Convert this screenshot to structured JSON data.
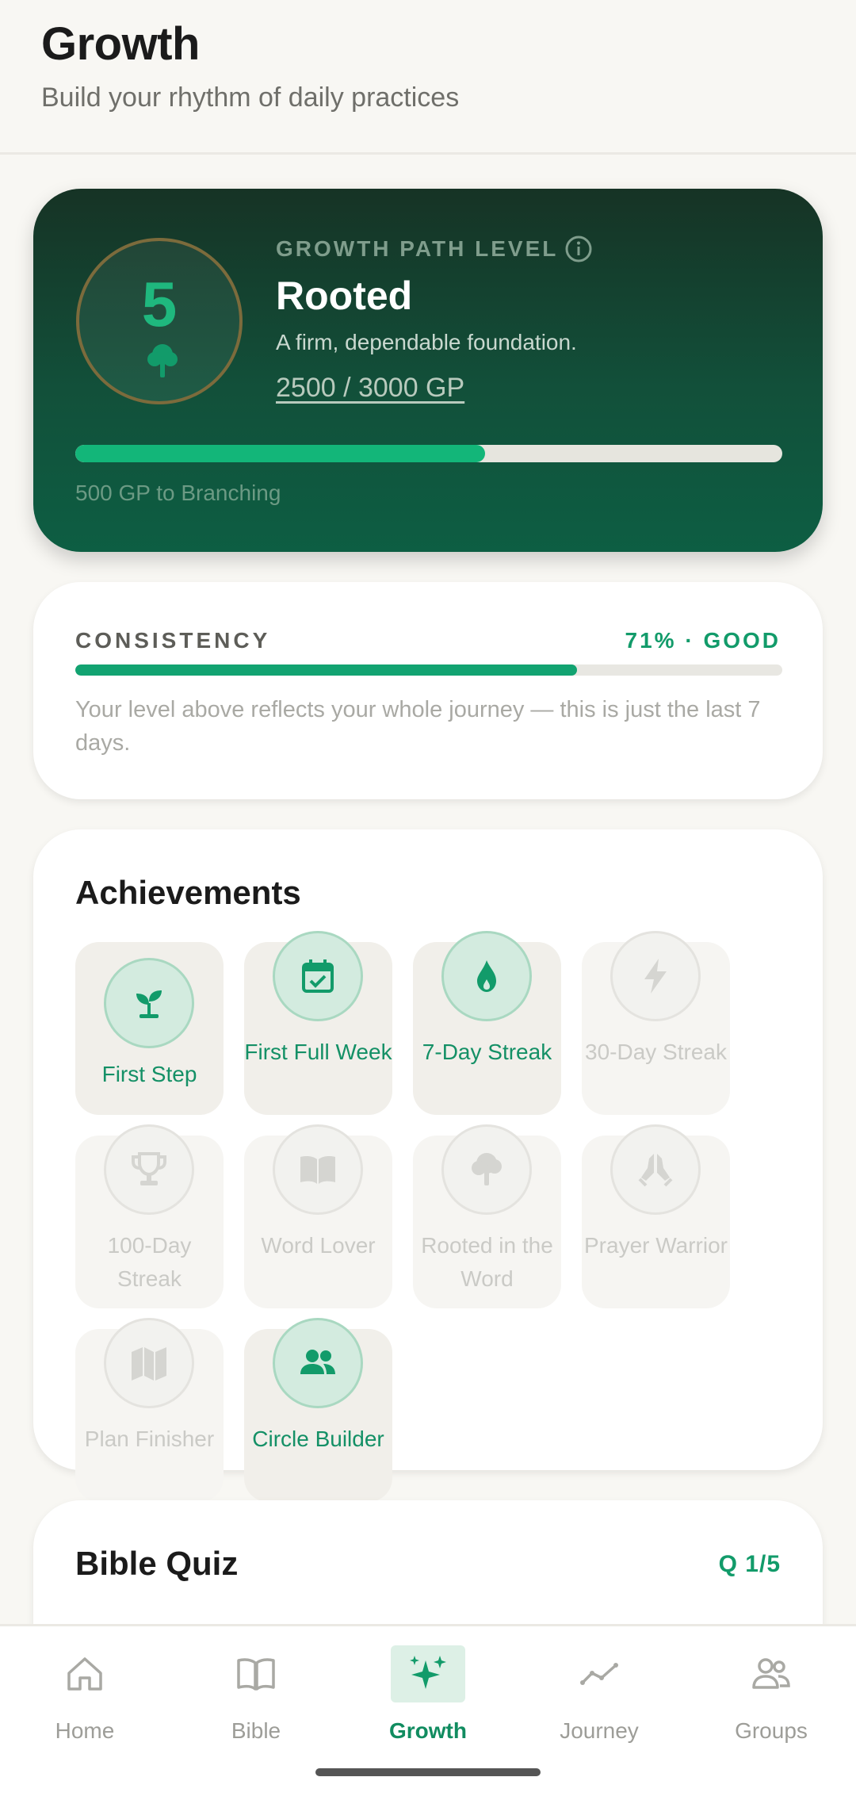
{
  "header": {
    "title": "Growth",
    "subtitle": "Build your rhythm of daily practices"
  },
  "level": {
    "number": "5",
    "label": "GROWTH PATH LEVEL",
    "name": "Rooted",
    "description": "A firm, dependable foundation.",
    "gp_text": "2500 / 3000 GP",
    "progress_fraction": 0.58,
    "next_text": "500 GP to Branching"
  },
  "consistency": {
    "label": "CONSISTENCY",
    "value": "71% · GOOD",
    "progress_fraction": 0.71,
    "note": "Your level above reflects your whole journey — this is just the last 7 days."
  },
  "achievements": {
    "title": "Achievements",
    "items": [
      {
        "label": "First Step",
        "icon": "sprout-icon",
        "unlocked": true
      },
      {
        "label": "First Full Week",
        "icon": "calendar-check-icon",
        "unlocked": true
      },
      {
        "label": "7-Day Streak",
        "icon": "flame-icon",
        "unlocked": true
      },
      {
        "label": "30-Day Streak",
        "icon": "bolt-icon",
        "unlocked": false
      },
      {
        "label": "100-Day Streak",
        "icon": "trophy-icon",
        "unlocked": false
      },
      {
        "label": "Word Lover",
        "icon": "book-icon",
        "unlocked": false
      },
      {
        "label": "Rooted in the Word",
        "icon": "tree-icon",
        "unlocked": false
      },
      {
        "label": "Prayer Warrior",
        "icon": "praying-hands-icon",
        "unlocked": false
      },
      {
        "label": "Plan Finisher",
        "icon": "map-icon",
        "unlocked": false
      },
      {
        "label": "Circle Builder",
        "icon": "people-icon",
        "unlocked": true
      }
    ]
  },
  "quiz": {
    "title": "Bible Quiz",
    "count": "Q 1/5"
  },
  "nav": {
    "items": [
      {
        "label": "Home",
        "icon": "home-icon"
      },
      {
        "label": "Bible",
        "icon": "book-icon"
      },
      {
        "label": "Growth",
        "icon": "sparkles-icon",
        "active": true
      },
      {
        "label": "Journey",
        "icon": "trend-line-icon"
      },
      {
        "label": "Groups",
        "icon": "people-icon"
      }
    ]
  },
  "colors": {
    "accent": "#129b6a",
    "card_dark": "#12503a",
    "background": "#f8f7f3"
  }
}
